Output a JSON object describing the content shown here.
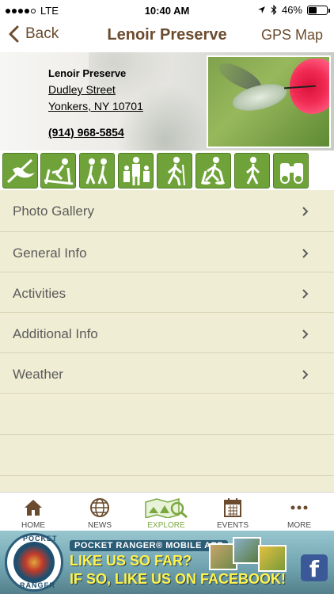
{
  "status_bar": {
    "carrier": "LTE",
    "time": "10:40 AM",
    "battery": "46%",
    "battery_level": 0.46
  },
  "nav": {
    "back_label": "Back",
    "title": "Lenoir Preserve",
    "gps_label": "GPS Map"
  },
  "header": {
    "name": "Lenoir Preserve",
    "street": "Dudley Street",
    "city": "Yonkers, NY 10701",
    "phone": "(914) 968-5854"
  },
  "activities": [
    {
      "icon": "bird-watching-icon"
    },
    {
      "icon": "cross-country-skiing-icon"
    },
    {
      "icon": "hiking-group-icon"
    },
    {
      "icon": "family-icon"
    },
    {
      "icon": "hiking-icon"
    },
    {
      "icon": "snowshoeing-icon"
    },
    {
      "icon": "walking-icon"
    },
    {
      "icon": "binoculars-icon"
    }
  ],
  "menu": [
    {
      "label": "Photo Gallery"
    },
    {
      "label": "General Info"
    },
    {
      "label": "Activities"
    },
    {
      "label": "Additional Info"
    },
    {
      "label": "Weather"
    }
  ],
  "tabs": [
    {
      "label": "HOME",
      "icon": "home-icon"
    },
    {
      "label": "NEWS",
      "icon": "globe-icon"
    },
    {
      "label": "EXPLORE",
      "icon": "explore-map-icon",
      "active": true
    },
    {
      "label": "EVENTS",
      "icon": "calendar-icon"
    },
    {
      "label": "MORE",
      "icon": "more-icon"
    }
  ],
  "ad": {
    "brand_top": "POCKET",
    "brand_bottom": "RANGER",
    "tagline": "POCKET RANGER® MOBILE APP",
    "line2": "LIKE US SO FAR?",
    "line3": "IF SO, LIKE US ON FACEBOOK!",
    "fb": "f"
  },
  "colors": {
    "accent_brown": "#6b4b2d",
    "activity_green": "#6fa33a",
    "menu_bg": "#efedd3",
    "tab_active": "#7aa840"
  }
}
